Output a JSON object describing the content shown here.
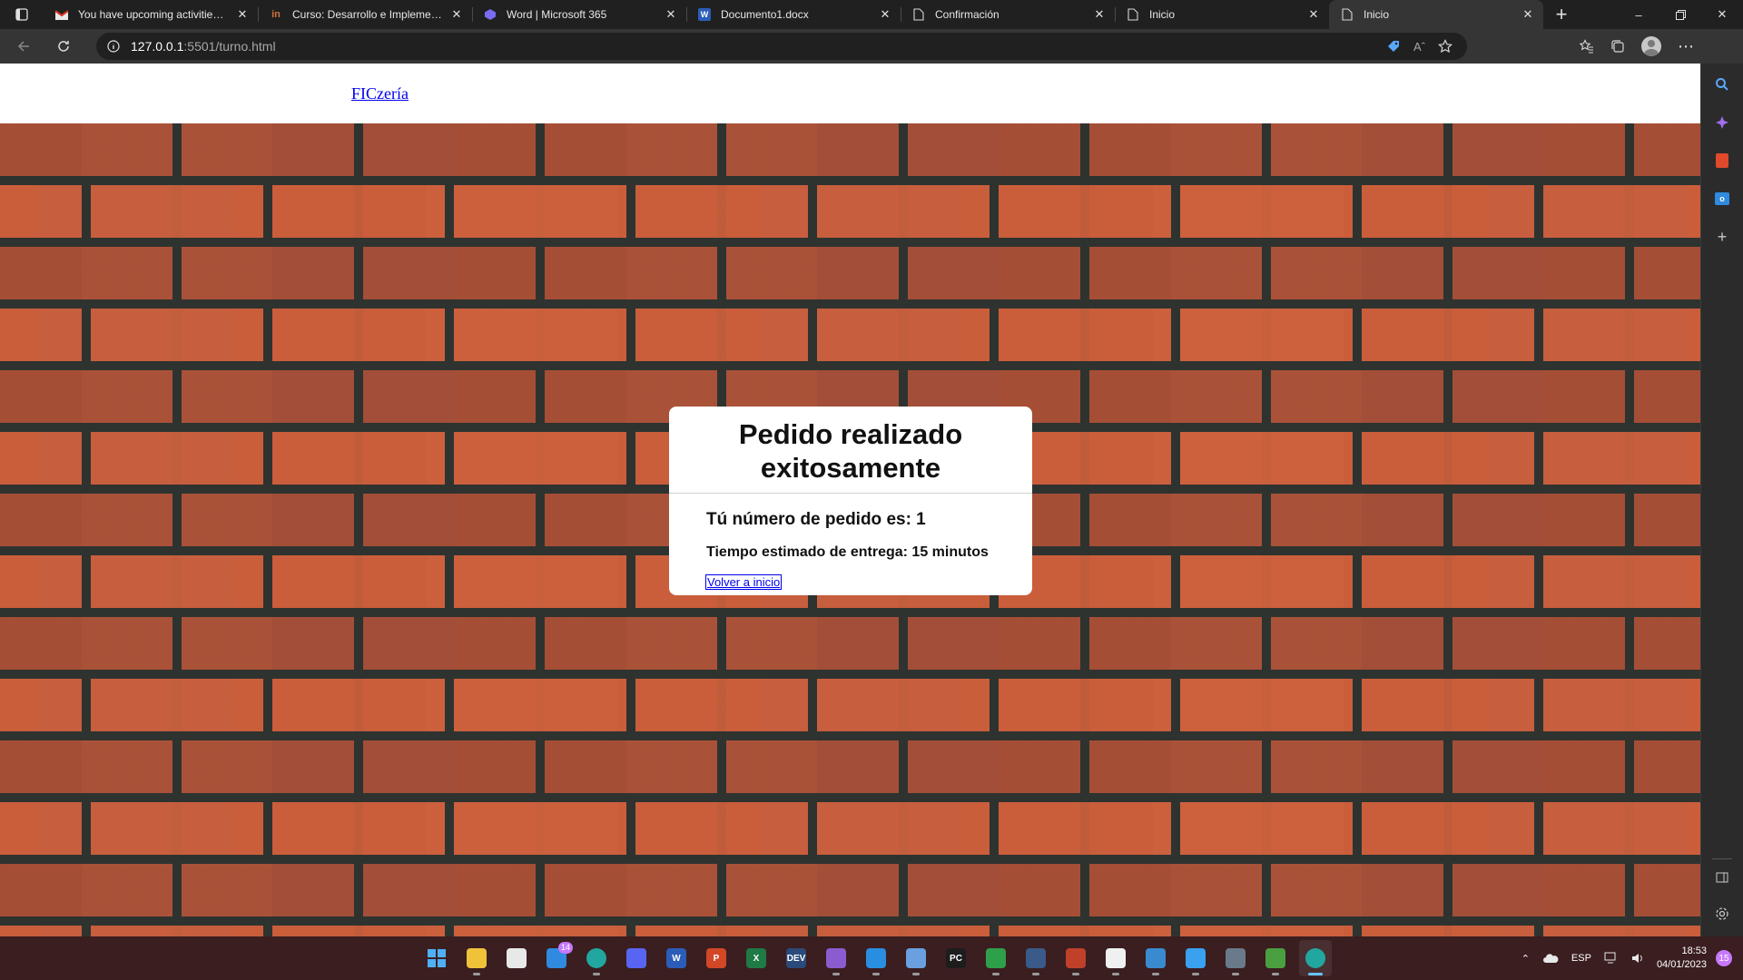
{
  "browser": {
    "tabs": [
      {
        "title": "You have upcoming activities du",
        "favicon": "gmail-icon",
        "active": false
      },
      {
        "title": "Curso: Desarrollo e Implementac",
        "favicon": "course-icon",
        "active": false
      },
      {
        "title": "Word | Microsoft 365",
        "favicon": "m365-icon",
        "active": false
      },
      {
        "title": "Documento1.docx",
        "favicon": "word-icon",
        "active": false
      },
      {
        "title": "Confirmación",
        "favicon": "page-icon",
        "active": false
      },
      {
        "title": "Inicio",
        "favicon": "page-icon",
        "active": false
      },
      {
        "title": "Inicio",
        "favicon": "page-icon",
        "active": true
      }
    ],
    "url_host": "127.0.0.1",
    "url_rest": ":5501/turno.html"
  },
  "site": {
    "brand": "FICzería"
  },
  "card": {
    "title": "Pedido realizado exitosamente",
    "order_text": "Tú número de pedido es: 1",
    "eta_text": "Tiempo estimado de entrega: 15 minutos",
    "back_link": "Volver a inicio"
  },
  "taskbar": {
    "apps": [
      {
        "name": "start-button",
        "label": "",
        "color": "#3aa0f0"
      },
      {
        "name": "file-explorer-icon",
        "label": "",
        "color": "#f0c23a"
      },
      {
        "name": "store-icon",
        "label": "",
        "color": "#e8e8e8"
      },
      {
        "name": "mail-icon",
        "label": "",
        "color": "#2f8ae0",
        "badge": "14"
      },
      {
        "name": "edge-icon",
        "label": "",
        "color": "#22a7a0"
      },
      {
        "name": "discord-icon",
        "label": "",
        "color": "#5865f2"
      },
      {
        "name": "word-icon",
        "label": "W",
        "color": "#2b5db8"
      },
      {
        "name": "powerpoint-icon",
        "label": "P",
        "color": "#d24726"
      },
      {
        "name": "excel-icon",
        "label": "X",
        "color": "#1f7a45"
      },
      {
        "name": "dev-icon",
        "label": "DEV",
        "color": "#2a4a7a"
      },
      {
        "name": "visual-studio-icon",
        "label": "",
        "color": "#8a5cd0"
      },
      {
        "name": "vscode-icon",
        "label": "",
        "color": "#2a8ee0"
      },
      {
        "name": "box-icon",
        "label": "",
        "color": "#6aa0e0"
      },
      {
        "name": "pycharm-icon",
        "label": "PC",
        "color": "#1d1d1d"
      },
      {
        "name": "tool-icon",
        "label": "",
        "color": "#2fa04a"
      },
      {
        "name": "wireshark-icon",
        "label": "",
        "color": "#3a5a8a"
      },
      {
        "name": "git-icon",
        "label": "",
        "color": "#c0402a"
      },
      {
        "name": "app-icon",
        "label": "",
        "color": "#f0f0f0"
      },
      {
        "name": "globe-icon",
        "label": "",
        "color": "#3a8ad0"
      },
      {
        "name": "notepad-icon",
        "label": "",
        "color": "#3aa0f0"
      },
      {
        "name": "calculator-icon",
        "label": "",
        "color": "#6a7a8a"
      },
      {
        "name": "minecraft-icon",
        "label": "",
        "color": "#4aa040"
      },
      {
        "name": "edge-active-icon",
        "label": "",
        "color": "#22a7a0",
        "active": true
      }
    ],
    "language": "ESP",
    "time": "18:53",
    "date": "04/01/2023",
    "notifications": "15"
  }
}
